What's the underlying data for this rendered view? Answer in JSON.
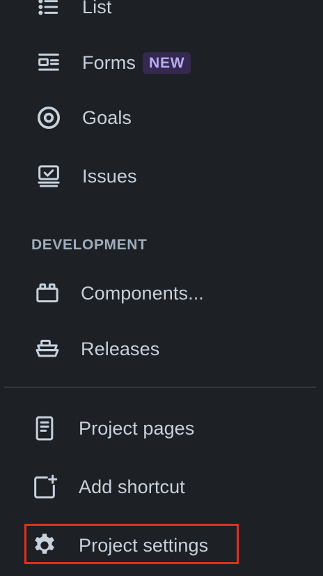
{
  "nav": {
    "list_label": "List",
    "forms_label": "Forms",
    "forms_badge": "NEW",
    "goals_label": "Goals",
    "issues_label": "Issues"
  },
  "development": {
    "heading": "DEVELOPMENT",
    "components_label": "Components...",
    "releases_label": "Releases"
  },
  "footer": {
    "project_pages_label": "Project pages",
    "add_shortcut_label": "Add shortcut",
    "project_settings_label": "Project settings"
  },
  "colors": {
    "background": "#1d2025",
    "text": "#c7d1db",
    "badge_bg": "#35294f",
    "badge_text": "#b8acf6",
    "highlight": "#e0301e"
  },
  "icons": {
    "list": "list-icon",
    "forms": "form-icon",
    "goals": "target-icon",
    "issues": "issues-icon",
    "components": "components-icon",
    "releases": "ship-icon",
    "project_pages": "page-icon",
    "add_shortcut": "add-shortcut-icon",
    "project_settings": "gear-icon"
  }
}
